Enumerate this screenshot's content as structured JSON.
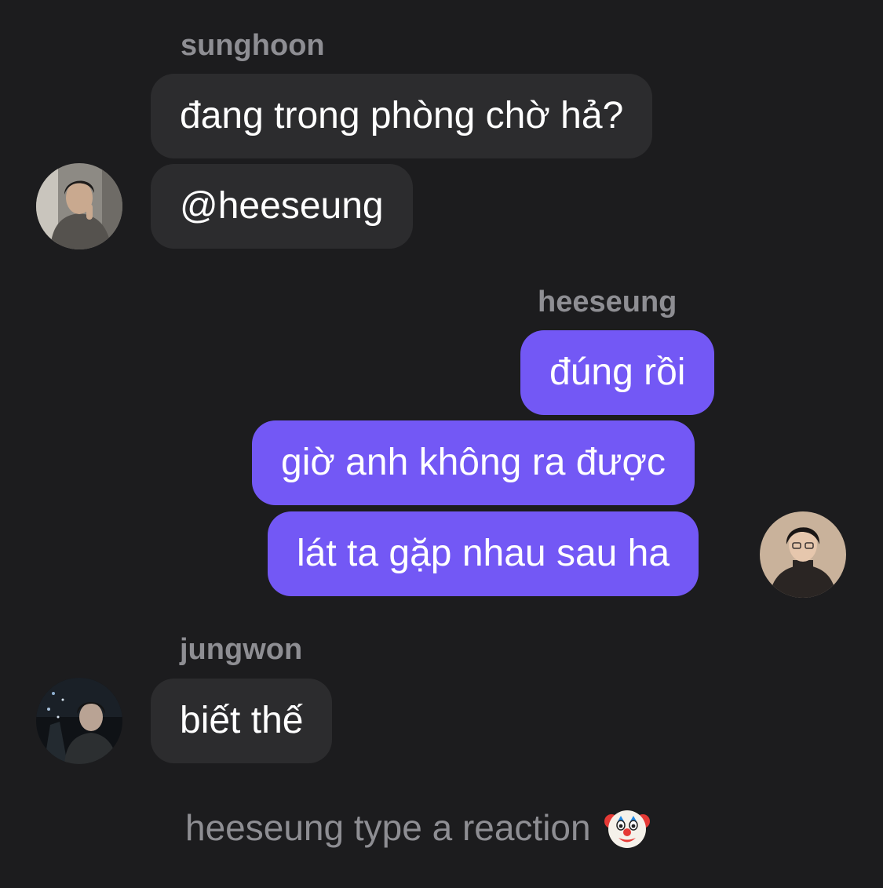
{
  "conversation": {
    "groups": [
      {
        "sender": "sunghoon",
        "direction": "received",
        "avatar_icon": "sunghoon-avatar",
        "messages": [
          "đang trong phòng chờ hả?",
          "@heeseung"
        ]
      },
      {
        "sender": "heeseung",
        "direction": "sent",
        "avatar_icon": "heeseung-avatar",
        "messages": [
          "đúng rồi",
          "giờ anh không ra được",
          "lát ta gặp nhau sau ha"
        ]
      },
      {
        "sender": "jungwon",
        "direction": "received",
        "avatar_icon": "jungwon-avatar",
        "messages": [
          "biết thế"
        ]
      }
    ],
    "reaction_prompt": {
      "text": "heeseung type a reaction",
      "emoji_icon": "clown-face-emoji"
    }
  },
  "colors": {
    "background": "#1c1c1e",
    "received_bubble": "#2c2c2e",
    "sent_bubble": "#7358f5",
    "sender_name": "#8e8e93",
    "message_text": "#ffffff"
  }
}
